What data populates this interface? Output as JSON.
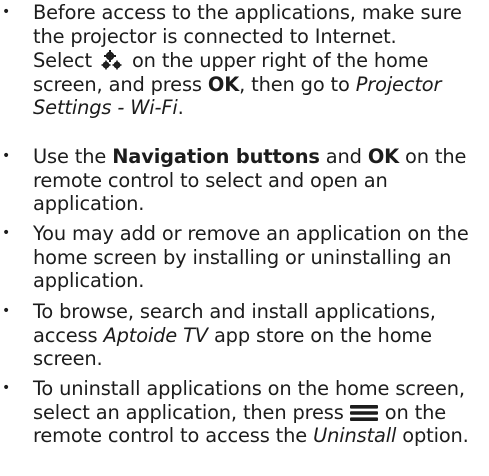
{
  "bullet": "•",
  "items": [
    {
      "text": "Before access to the applications, make sure the projector is connected to Internet.",
      "sub": {
        "a": "Select",
        "icon": "settings-gear-icon",
        "b": "on the upper right of the home screen, and press",
        "ok": "OK",
        "c": ", then go to",
        "path": "Projector Settings - Wi-Fi",
        "end": "."
      }
    },
    {
      "a": "Use the",
      "nav": "Navigation buttons",
      "b": "and",
      "ok": "OK",
      "c": "on the remote control to select and open an application."
    },
    {
      "text": "You may add or remove an application on the home screen by installing or uninstalling an application."
    },
    {
      "a": "To browse, search and install applications, access",
      "store": "Aptoide TV",
      "b": "app store on the home screen."
    },
    {
      "a": "To uninstall applications on the home screen, select an application, then press",
      "icon": "menu-icon",
      "b": "on the remote control to access the",
      "option": "Uninstall",
      "c": "option."
    }
  ]
}
